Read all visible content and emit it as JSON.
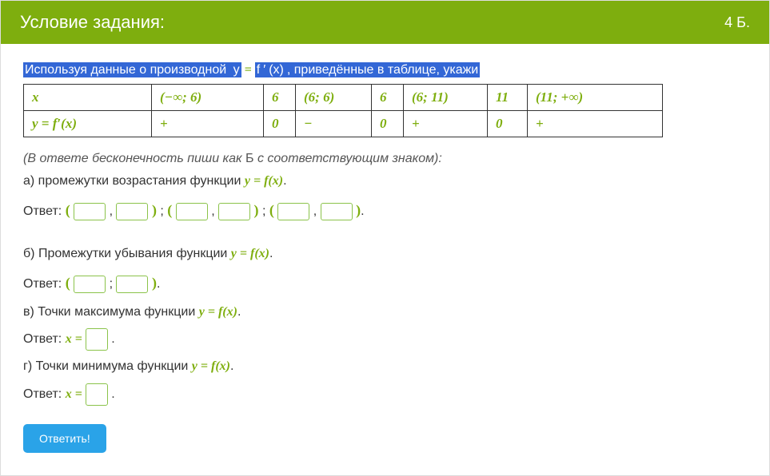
{
  "header": {
    "title": "Условие задания:",
    "points": "4 Б."
  },
  "intro": {
    "part1": "Используя данные о производной ",
    "eq_y": "y",
    "eq_eq": " = ",
    "eq_f": "f",
    "eq_prime": "′",
    "eq_x": "(x)",
    "part2": ", приведённые в таблице, укажи"
  },
  "table": {
    "row1": [
      "x",
      "(−∞; 6)",
      "6",
      "(6; 6)",
      "6",
      "(6; 11)",
      "11",
      "(11; +∞)"
    ],
    "row2": [
      "y = f′(x)",
      "+",
      "0",
      "−",
      "0",
      "+",
      "0",
      "+"
    ]
  },
  "note": {
    "text": "(В ответе бесконечность пиши как ",
    "b": "Б",
    "text2": " с соответствующим знаком):"
  },
  "qa": {
    "label": "а) промежутки возрастания функции ",
    "eq": "y = f(x)",
    "dot": "."
  },
  "answer_label": "Ответ: ",
  "qb": {
    "label": "б) Промежутки убывания функции ",
    "eq": "y = f(x)",
    "dot": "."
  },
  "qc": {
    "label": "в) Точки максимума функции ",
    "eq": "y = f(x)",
    "dot": "."
  },
  "xeq": "x = ",
  "qd": {
    "label": "г) Точки минимума функции ",
    "eq": "y = f(x)",
    "dot": "."
  },
  "submit": "Ответить!"
}
